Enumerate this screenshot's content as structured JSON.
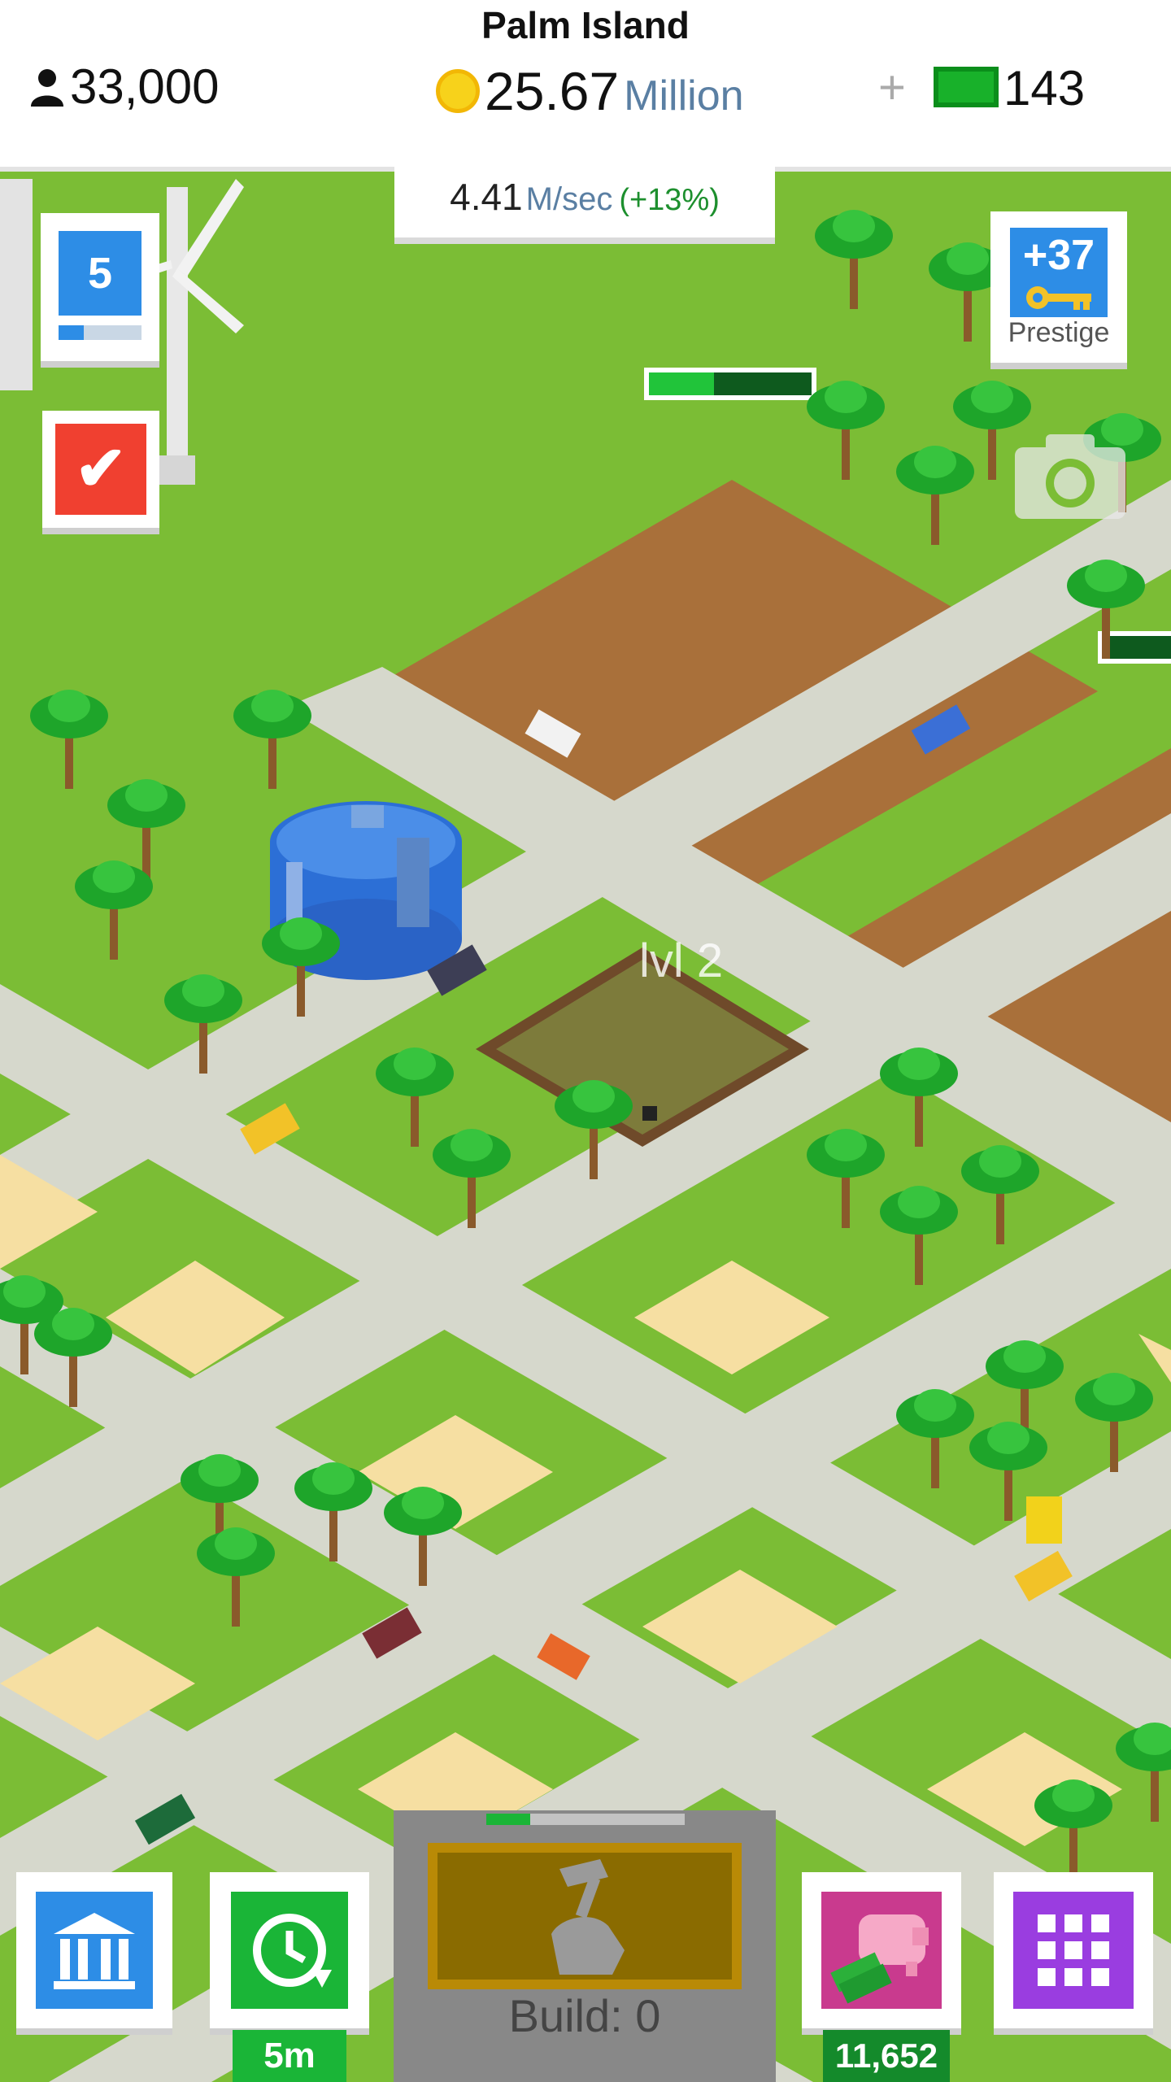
{
  "header": {
    "city_name": "Palm Island",
    "population": "33,000",
    "money_value": "25.67",
    "money_unit": "Million",
    "plus": "+",
    "cash": "143"
  },
  "income": {
    "value": "4.41",
    "unit": "M/sec",
    "bonus": "(+13%)"
  },
  "level": {
    "number": "5",
    "progress": 0.3
  },
  "prestige": {
    "value": "+37",
    "label": "Prestige"
  },
  "map": {
    "building_level_label": "lvl 2"
  },
  "bottom": {
    "timer_label": "5m",
    "build_label": "Build: 0",
    "build_progress": 0.22,
    "piggy_label": "11,652"
  },
  "colors": {
    "grass": "#7bbd35",
    "road": "#d6d8cc",
    "dirt": "#a9703a",
    "sand": "#f6dfa2",
    "accent_blue": "#2d8de6",
    "accent_green": "#1ab537",
    "accent_red": "#f04030",
    "accent_purple": "#9a3de0",
    "accent_pink": "#c93a8e"
  },
  "icons": {
    "population": "person-icon",
    "money": "coin-icon",
    "cash": "cash-icon",
    "check": "checkmark-icon",
    "prestige": "key-icon",
    "camera": "camera-icon",
    "bank": "bank-icon",
    "timer": "clock-refresh-icon",
    "build": "hammer-hand-icon",
    "piggy": "piggy-bank-icon",
    "menu": "grid-icon"
  }
}
